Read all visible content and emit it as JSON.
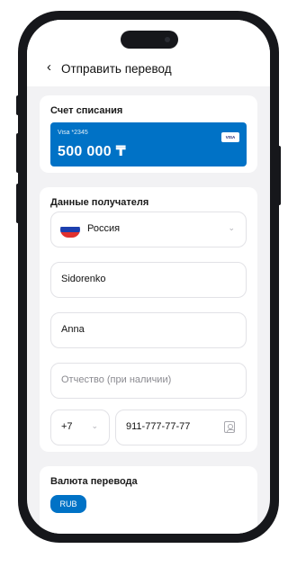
{
  "header": {
    "back_glyph": "‹",
    "title": "Отправить перевод"
  },
  "debit_account": {
    "section_title": "Счет списания",
    "card_number": "Visa *2345",
    "balance": "500 000 ₸",
    "card_brand": "VISA",
    "card_color": "#0072c6"
  },
  "recipient": {
    "section_title": "Данные получателя",
    "country": {
      "label": "Россия",
      "flag_colors": [
        "#ffffff",
        "#1c3fae",
        "#e0312f"
      ]
    },
    "last_name": {
      "value": "Sidorenko"
    },
    "first_name": {
      "value": "Anna"
    },
    "patronymic": {
      "placeholder": "Отчество (при наличии)"
    },
    "phone": {
      "country_code": "+7",
      "number": "911-777-77-77"
    }
  },
  "currency": {
    "section_title": "Валюта перевода",
    "selected": "RUB"
  },
  "icons": [
    "back-icon",
    "chevron-down-icon",
    "contact-book-icon",
    "visa-logo-icon",
    "russia-flag-icon"
  ]
}
